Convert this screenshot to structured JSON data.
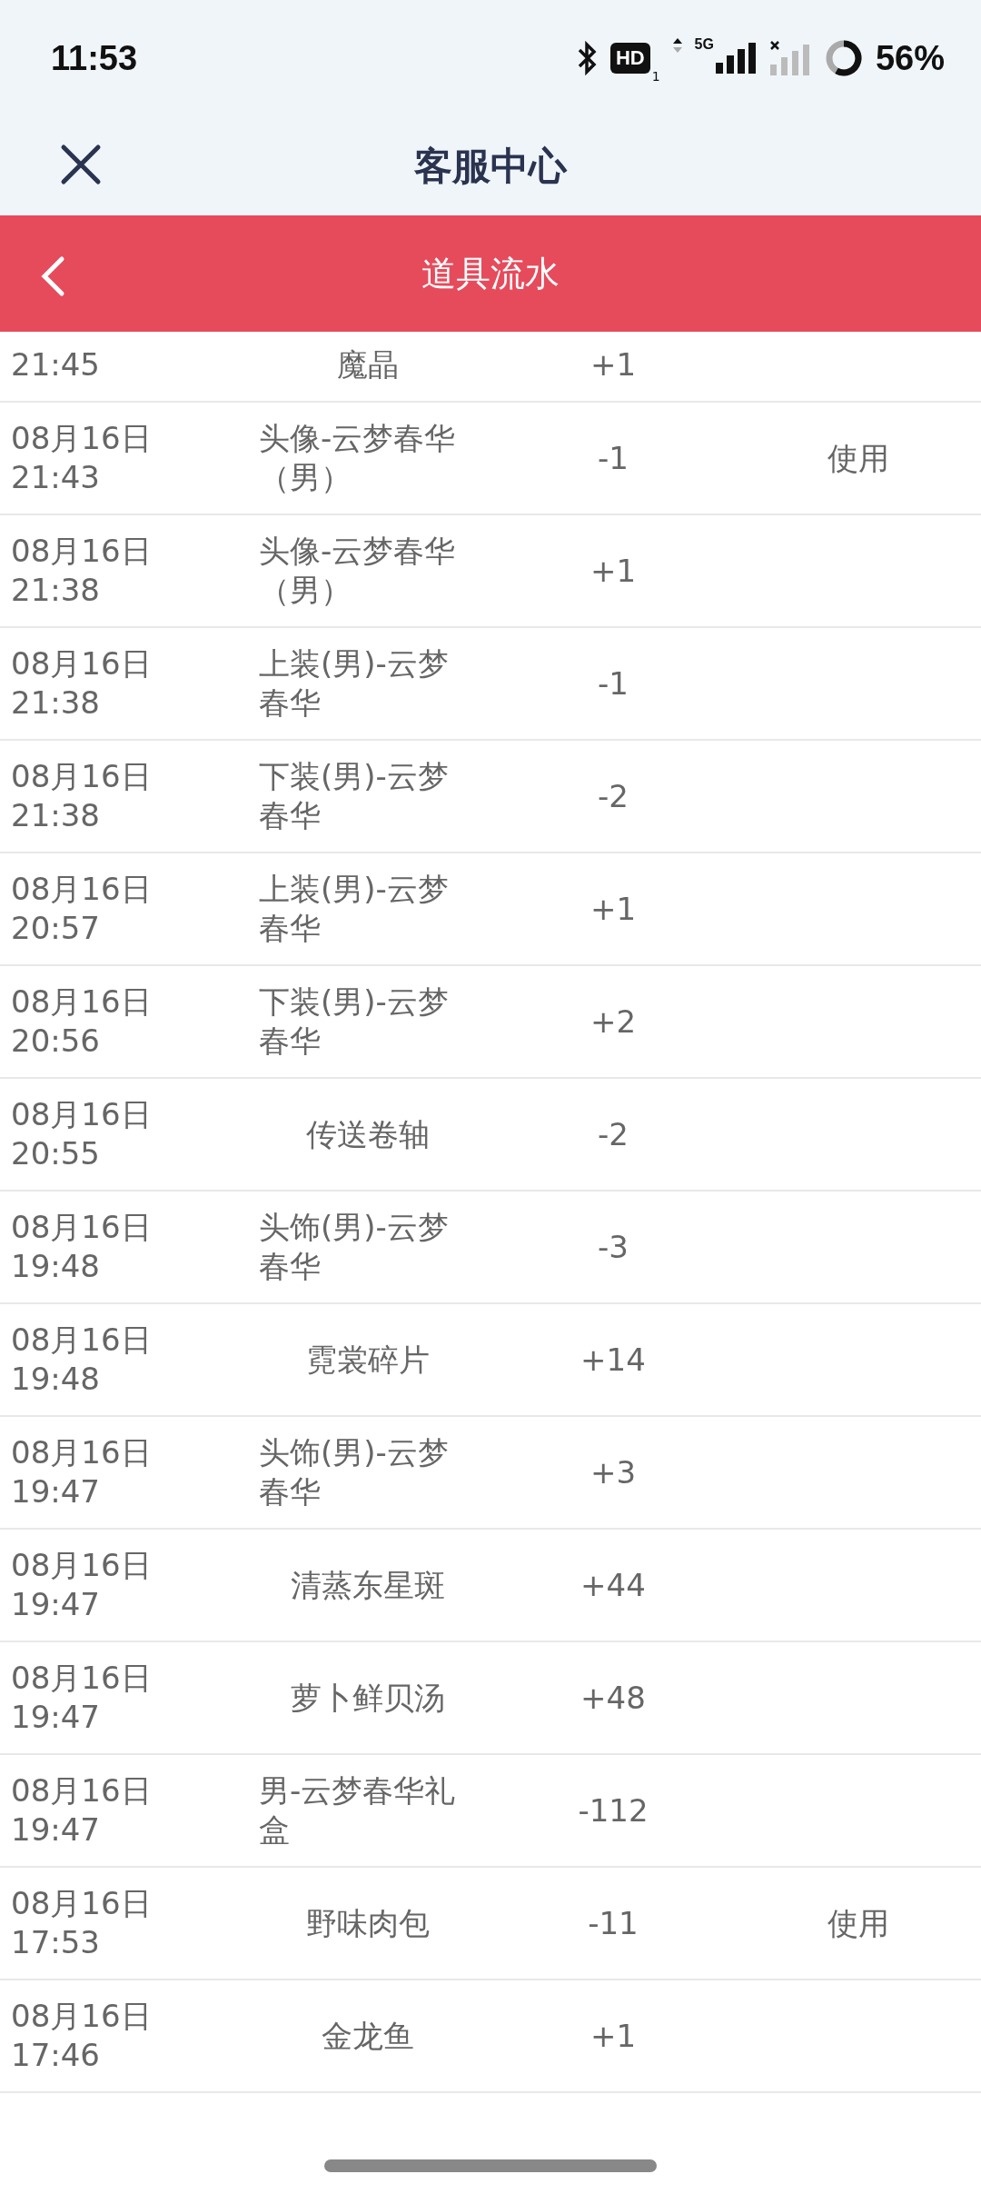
{
  "status_bar": {
    "time": "11:53",
    "hd": "HD",
    "sim": "1",
    "network": "5G",
    "battery": "56%"
  },
  "nav": {
    "title": "客服中心"
  },
  "toolbar": {
    "title": "道具流水"
  },
  "rows": [
    {
      "time": "21:45",
      "item": "魔晶",
      "qty": "+1"
    },
    {
      "date": "08月16日",
      "time": "21:43",
      "item": "头像-云梦春华（男）",
      "qty": "-1",
      "action": "使用"
    },
    {
      "date": "08月16日",
      "time": "21:38",
      "item": "头像-云梦春华（男）",
      "qty": "+1"
    },
    {
      "date": "08月16日",
      "time": "21:38",
      "item": "上装(男)-云梦春华",
      "qty": "-1"
    },
    {
      "date": "08月16日",
      "time": "21:38",
      "item": "下装(男)-云梦春华",
      "qty": "-2"
    },
    {
      "date": "08月16日",
      "time": "20:57",
      "item": "上装(男)-云梦春华",
      "qty": "+1"
    },
    {
      "date": "08月16日",
      "time": "20:56",
      "item": "下装(男)-云梦春华",
      "qty": "+2"
    },
    {
      "date": "08月16日",
      "time": "20:55",
      "item": "传送卷轴",
      "qty": "-2"
    },
    {
      "date": "08月16日",
      "time": "19:48",
      "item": "头饰(男)-云梦春华",
      "qty": "-3"
    },
    {
      "date": "08月16日",
      "time": "19:48",
      "item": "霓裳碎片",
      "qty": "+14"
    },
    {
      "date": "08月16日",
      "time": "19:47",
      "item": "头饰(男)-云梦春华",
      "qty": "+3"
    },
    {
      "date": "08月16日",
      "time": "19:47",
      "item": "清蒸东星斑",
      "qty": "+44"
    },
    {
      "date": "08月16日",
      "time": "19:47",
      "item": "萝卜鲜贝汤",
      "qty": "+48"
    },
    {
      "date": "08月16日",
      "time": "19:47",
      "item": "男-云梦春华礼盒",
      "qty": "-112"
    },
    {
      "date": "08月16日",
      "time": "17:53",
      "item": "野味肉包",
      "qty": "-11",
      "action": "使用"
    },
    {
      "date": "08月16日",
      "time": "17:46",
      "item": "金龙鱼",
      "qty": "+1"
    }
  ]
}
